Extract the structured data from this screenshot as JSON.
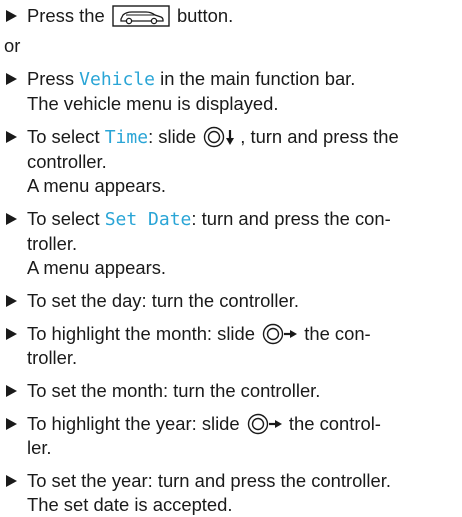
{
  "steps": [
    {
      "pre": "Press the",
      "post": "button."
    },
    {
      "text": "or"
    },
    {
      "pre": "Press",
      "kw": "Vehicle",
      "post": "in the main function bar.",
      "cont": [
        "The vehicle menu is displayed."
      ]
    },
    {
      "pre": "To select",
      "kw": "Time",
      "mid": ": slide",
      "post": ", turn and press the",
      "cont": [
        "controller.",
        "A menu appears."
      ]
    },
    {
      "pre": "To select",
      "kw": "Set Date",
      "post": ": turn and press the con-",
      "cont": [
        "troller.",
        "A menu appears."
      ]
    },
    {
      "text": "To set the day: turn the controller."
    },
    {
      "pre": "To highlight the month: slide",
      "post": "the con-",
      "cont": [
        "troller."
      ]
    },
    {
      "text": "To set the month: turn the controller."
    },
    {
      "pre": "To highlight the year: slide",
      "post": "the control-",
      "cont": [
        "ler."
      ]
    },
    {
      "text": "To set the year: turn and press the controller.",
      "cont": [
        "The set date is accepted."
      ]
    }
  ],
  "icons": {
    "bullet": "triangle-right-icon",
    "vehicle_button": "car-button-icon",
    "controller_down": "controller-slide-down-icon",
    "controller_right": "controller-slide-right-icon"
  },
  "colors": {
    "keyword": "#2aa5d6",
    "text": "#1a1a1a"
  }
}
